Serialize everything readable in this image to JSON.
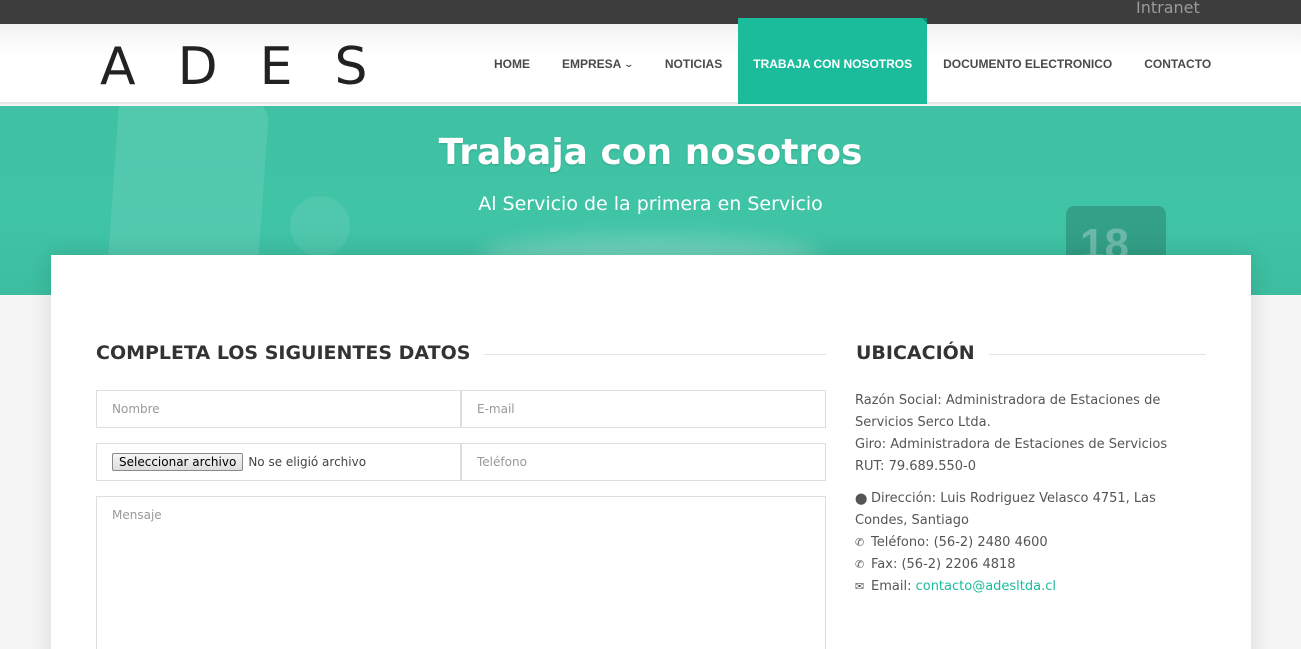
{
  "topbar": {
    "intranet": "Intranet"
  },
  "logo": {
    "letters": [
      "A",
      "D",
      "E",
      "S"
    ]
  },
  "nav": {
    "items": [
      {
        "label": "HOME"
      },
      {
        "label": "EMPRESA"
      },
      {
        "label": "NOTICIAS"
      },
      {
        "label": "TRABAJA CON NOSOTROS",
        "active": true
      },
      {
        "label": "DOCUMENTO ELECTRONICO"
      },
      {
        "label": "CONTACTO"
      }
    ]
  },
  "hero": {
    "title": "Trabaja con nosotros",
    "subtitle": "Al Servicio de la primera en Servicio",
    "badge_number": "18"
  },
  "form": {
    "title": "COMPLETA LOS SIGUIENTES DATOS",
    "name_placeholder": "Nombre",
    "email_placeholder": "E-mail",
    "file_button": "Seleccionar archivo",
    "file_status": "No se eligió archivo",
    "phone_placeholder": "Teléfono",
    "message_placeholder": "Mensaje"
  },
  "location": {
    "title": "UBICACIÓN",
    "razon_social": "Razón Social: Administradora de Estaciones de Servicios Serco Ltda.",
    "giro": "Giro: Administradora de Estaciones de Servicios",
    "rut": "RUT: 79.689.550-0",
    "direccion": "Dirección: Luis Rodriguez Velasco 4751, Las Condes, Santiago",
    "telefono": "Teléfono: (56-2) 2480 4600",
    "fax": "Fax: (56-2) 2206 4818",
    "email_label": "Email:",
    "email": "contacto@adesltda.cl"
  },
  "colors": {
    "accent": "#1abc9c",
    "topbar": "#3d3d3d"
  }
}
